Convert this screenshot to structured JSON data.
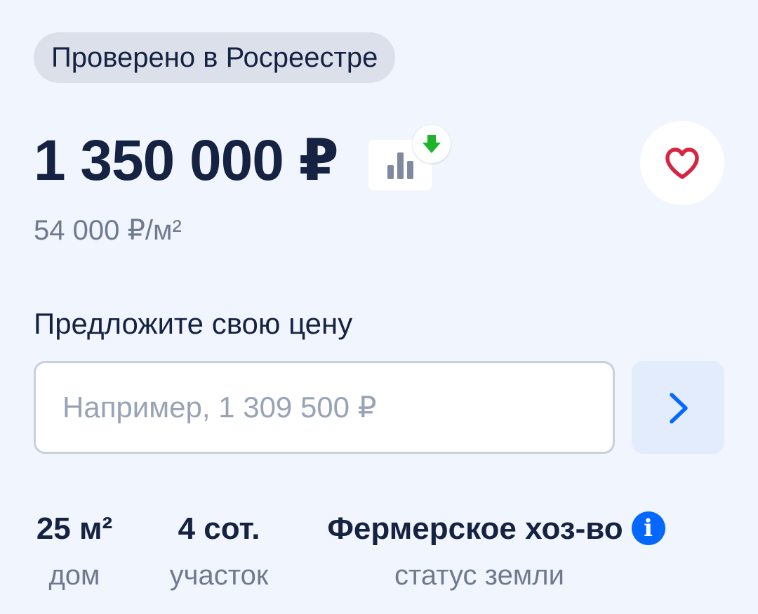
{
  "badge": {
    "label": "Проверено в Росреестре"
  },
  "price": {
    "value": "1 350 000 ₽",
    "per_m2": "54 000 ₽/м²",
    "trend": "down",
    "trend_color": "#1db42b"
  },
  "favorite": {
    "icon": "heart-icon",
    "color": "#d62541"
  },
  "offer": {
    "title": "Предложите свою цену",
    "placeholder": "Например, 1 309 500 ₽",
    "value": "",
    "submit_icon": "chevron-right-icon"
  },
  "stats": [
    {
      "value": "25 м²",
      "label": "дом"
    },
    {
      "value": "4 сот.",
      "label": "участок"
    },
    {
      "value": "Фермерское хоз-во",
      "label": "статус земли",
      "info_icon": "i"
    }
  ],
  "colors": {
    "background": "#f1f5fd",
    "text_primary": "#152242",
    "text_secondary": "#707a8f",
    "accent": "#0468ff",
    "button_tint": "#e3ecfc"
  }
}
